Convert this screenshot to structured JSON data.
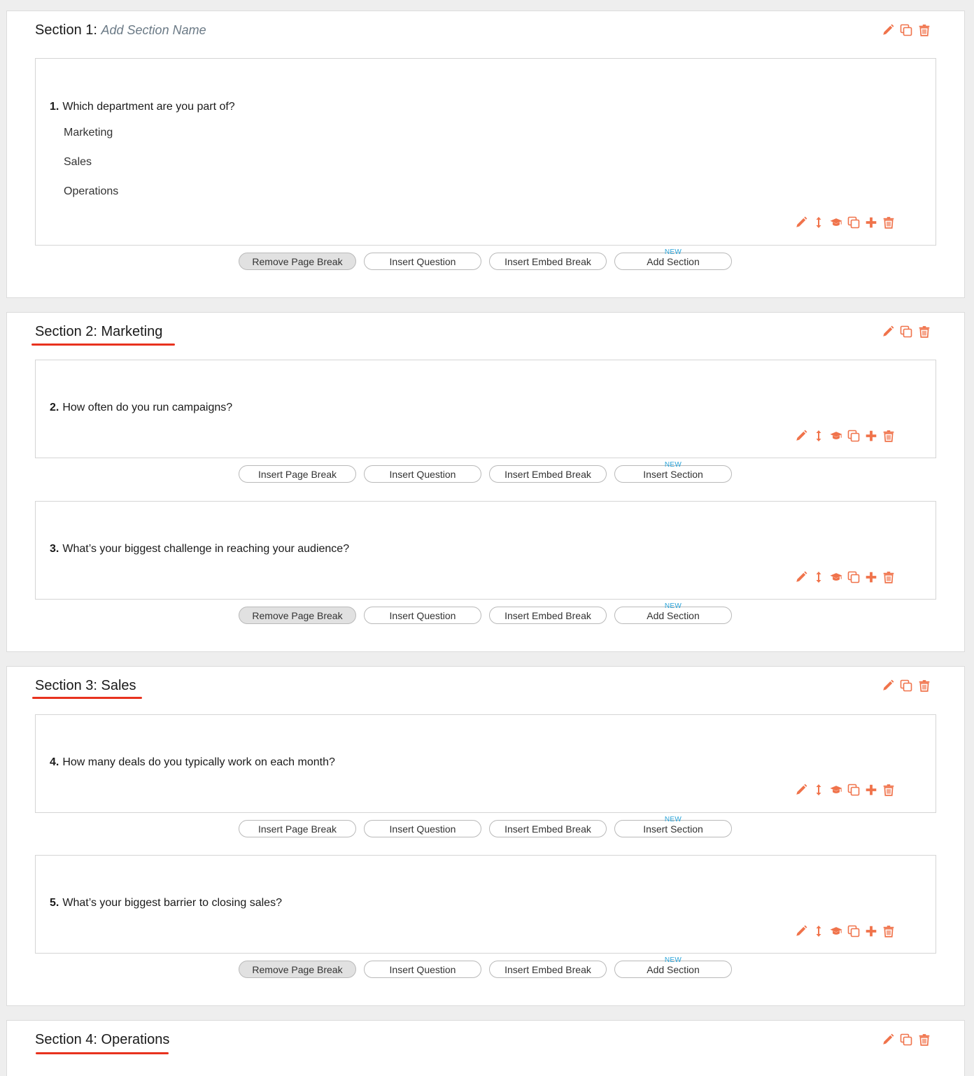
{
  "colors": {
    "accent": "#f0734b",
    "underline": "#e8321e",
    "new_badge": "#29a3d8"
  },
  "icons": {
    "section": [
      "pencil-icon",
      "duplicate-icon",
      "trash-icon"
    ],
    "question": [
      "pencil-icon",
      "move-icon",
      "graduation-cap-icon",
      "duplicate-icon",
      "plus-icon",
      "trash-icon"
    ]
  },
  "new_badge": "NEW",
  "sections": [
    {
      "prefix": "Section 1:",
      "placeholder": "Add Section Name",
      "questions": [
        {
          "number": "1.",
          "text": "Which department are you part of?",
          "options": [
            "Marketing",
            "Sales",
            "Operations"
          ],
          "buttons": [
            "Remove Page Break",
            "Insert Question",
            "Insert Embed Break",
            "Add Section"
          ]
        }
      ]
    },
    {
      "prefix": "Section 2:",
      "name": "Marketing",
      "questions": [
        {
          "number": "2.",
          "text": "How often do you run campaigns?",
          "buttons": [
            "Insert Page Break",
            "Insert Question",
            "Insert Embed Break",
            "Insert Section"
          ]
        },
        {
          "number": "3.",
          "text": "What’s your biggest challenge in reaching your audience?",
          "buttons": [
            "Remove Page Break",
            "Insert Question",
            "Insert Embed Break",
            "Add Section"
          ]
        }
      ]
    },
    {
      "prefix": "Section 3:",
      "name": "Sales",
      "questions": [
        {
          "number": "4.",
          "text": "How many deals do you typically work on each month?",
          "buttons": [
            "Insert Page Break",
            "Insert Question",
            "Insert Embed Break",
            "Insert Section"
          ]
        },
        {
          "number": "5.",
          "text": "What’s your biggest barrier to closing sales?",
          "buttons": [
            "Remove Page Break",
            "Insert Question",
            "Insert Embed Break",
            "Add Section"
          ]
        }
      ]
    },
    {
      "prefix": "Section 4:",
      "name": "Operations",
      "questions": []
    }
  ]
}
